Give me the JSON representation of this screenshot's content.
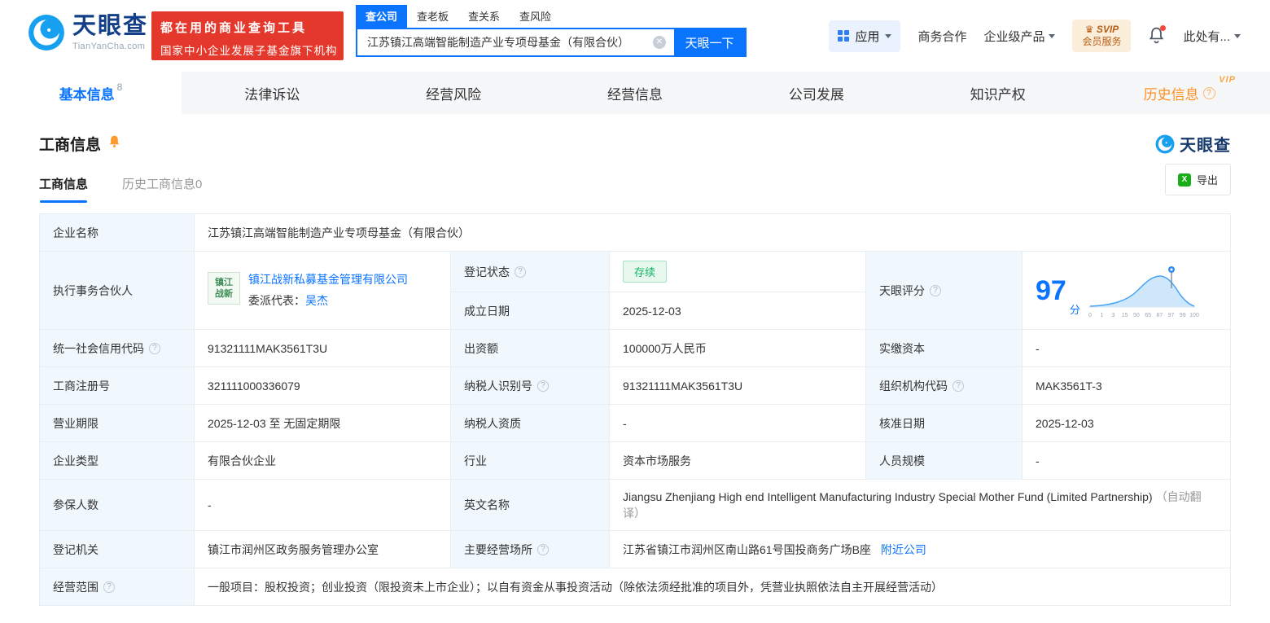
{
  "brand": {
    "name": "天眼查",
    "domain": "TianYanCha.com",
    "accent": "#0b74ff"
  },
  "header": {
    "promo_line1": "都在用的商业查询工具",
    "promo_line2": "国家中小企业发展子基金旗下机构",
    "search_tabs": [
      {
        "label": "查公司"
      },
      {
        "label": "查老板"
      },
      {
        "label": "查关系"
      },
      {
        "label": "查风险"
      }
    ],
    "search_value": "江苏镇江高端智能制造产业专项母基金（有限合伙）",
    "search_button": "天眼一下",
    "apps_label": "应用",
    "biz_coop": "商务合作",
    "enterprise_products": "企业级产品",
    "svip_top": "SVIP",
    "svip_bottom": "会员服务",
    "user_more": "此处有..."
  },
  "nav_tabs": [
    {
      "label": "基本信息",
      "badge": "8"
    },
    {
      "label": "法律诉讼"
    },
    {
      "label": "经营风险"
    },
    {
      "label": "经营信息"
    },
    {
      "label": "公司发展"
    },
    {
      "label": "知识产权"
    },
    {
      "label": "历史信息",
      "vip": "VIP"
    }
  ],
  "section": {
    "title": "工商信息",
    "subtab_active": "工商信息",
    "subtab_history": "历史工商信息0",
    "export_label": "导出"
  },
  "score_chart": {
    "type": "area",
    "score": "97",
    "unit": "分",
    "x_ticks": [
      "0",
      "1",
      "3",
      "15",
      "50",
      "65",
      "87",
      "97",
      "99",
      "100"
    ],
    "marker_at": "97",
    "curve_color": "#49a4f5",
    "fill_color": "#cfe7fb"
  },
  "info": {
    "name_label": "企业名称",
    "name": "江苏镇江高端智能制造产业专项母基金（有限合伙）",
    "partner_label": "执行事务合伙人",
    "partner_logo_line1": "镇江",
    "partner_logo_line2": "战新",
    "partner_company": "镇江战新私募基金管理有限公司",
    "rep_label": "委派代表：",
    "rep_name": "吴杰",
    "status_label": "登记状态",
    "status_value": "存续",
    "established_label": "成立日期",
    "established_value": "2025-12-03",
    "score_label": "天眼评分",
    "credit_code_label": "统一社会信用代码",
    "credit_code": "91321111MAK3561T3U",
    "capital_label": "出资额",
    "capital": "100000万人民币",
    "paid_capital_label": "实缴资本",
    "paid_capital": "-",
    "reg_no_label": "工商注册号",
    "reg_no": "321111000336079",
    "tax_id_label": "纳税人识别号",
    "tax_id": "91321111MAK3561T3U",
    "org_code_label": "组织机构代码",
    "org_code": "MAK3561T-3",
    "term_label": "营业期限",
    "term": "2025-12-03 至 无固定期限",
    "tax_qual_label": "纳税人资质",
    "tax_qual": "-",
    "approval_label": "核准日期",
    "approval": "2025-12-03",
    "type_label": "企业类型",
    "type": "有限合伙企业",
    "industry_label": "行业",
    "industry": "资本市场服务",
    "staff_label": "人员规模",
    "staff": "-",
    "insured_label": "参保人数",
    "insured": "-",
    "en_name_label": "英文名称",
    "en_name": "Jiangsu Zhenjiang High end Intelligent Manufacturing Industry Special Mother Fund (Limited Partnership)",
    "en_note": "（自动翻译）",
    "authority_label": "登记机关",
    "authority": "镇江市润州区政务服务管理办公室",
    "premises_label": "主要经营场所",
    "premises": "江苏省镇江市润州区南山路61号国投商务广场B座",
    "nearby_link": "附近公司",
    "scope_label": "经营范围",
    "scope": "一般项目：股权投资；创业投资（限投资未上市企业）；以自有资金从事投资活动（除依法须经批准的项目外，凭营业执照依法自主开展经营活动）"
  }
}
